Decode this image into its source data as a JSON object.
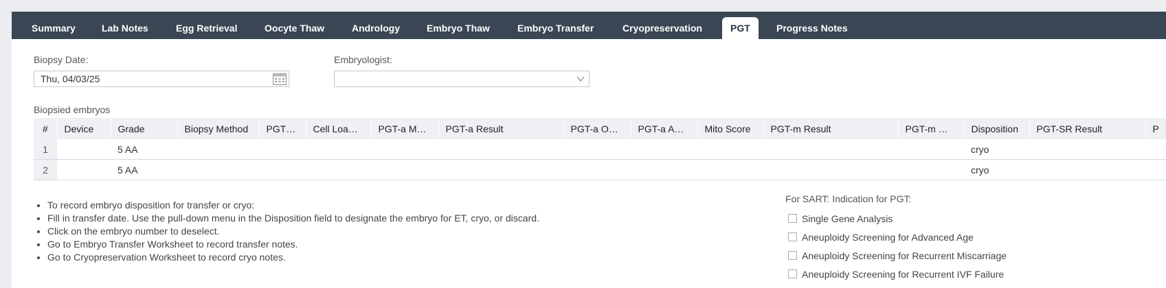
{
  "tabs": [
    {
      "label": "Summary"
    },
    {
      "label": "Lab Notes"
    },
    {
      "label": "Egg Retrieval"
    },
    {
      "label": "Oocyte Thaw"
    },
    {
      "label": "Andrology"
    },
    {
      "label": "Embryo Thaw"
    },
    {
      "label": "Embryo Transfer"
    },
    {
      "label": "Cryopreservation"
    },
    {
      "label": "PGT",
      "active": true
    },
    {
      "label": "Progress Notes"
    }
  ],
  "form": {
    "biopsy_date_label": "Biopsy Date:",
    "biopsy_date_value": "Thu, 04/03/25",
    "embryologist_label": "Embryologist:",
    "embryologist_value": ""
  },
  "table": {
    "section_label": "Biopsied embryos",
    "columns": [
      "#",
      "Device",
      "Grade",
      "Biopsy Method",
      "PGT…",
      "Cell Loa…",
      "PGT-a M…",
      "PGT-a Result",
      "PGT-a O…",
      "PGT-a A…",
      "Mito Score",
      "PGT-m Result",
      "PGT-m …",
      "Disposition",
      "PGT-SR Result",
      "P"
    ],
    "rows": [
      {
        "num": "1",
        "device": "",
        "grade": "5 AA",
        "biopsy_method": "",
        "pgt": "",
        "cell_load": "",
        "pgta_m": "",
        "pgta_result": "",
        "pgta_o": "",
        "pgta_a": "",
        "mito": "",
        "pgtm_result": "",
        "pgtm": "",
        "disposition": "cryo",
        "pgtsr": "",
        "p": ""
      },
      {
        "num": "2",
        "device": "",
        "grade": "5 AA",
        "biopsy_method": "",
        "pgt": "",
        "cell_load": "",
        "pgta_m": "",
        "pgta_result": "",
        "pgta_o": "",
        "pgta_a": "",
        "mito": "",
        "pgtm_result": "",
        "pgtm": "",
        "disposition": "cryo",
        "pgtsr": "",
        "p": ""
      }
    ]
  },
  "notes": [
    "To record embryo disposition for transfer or cryo:",
    "Fill in transfer date. Use the pull-down menu in the Disposition field to designate the embryo for ET, cryo, or discard.",
    "Click on the embryo number to deselect.",
    "Go to Embryo Transfer Worksheet to record transfer notes.",
    "Go to Cryopreservation Worksheet to record cryo notes."
  ],
  "sart": {
    "title": "For SART: Indication for PGT:",
    "options": [
      {
        "label": "Single Gene Analysis",
        "checked": false
      },
      {
        "label": "Aneuploidy Screening for Advanced Age",
        "checked": false
      },
      {
        "label": "Aneuploidy Screening for Recurrent Miscarriage",
        "checked": false
      },
      {
        "label": "Aneuploidy Screening for Recurrent IVF Failure",
        "checked": false
      }
    ]
  },
  "icons": {
    "date_picker": "calendar-icon",
    "dropdown": "chevron-down-icon"
  },
  "colors": {
    "tabbar": "#3a4654",
    "header_bg": "#eef0f3"
  }
}
